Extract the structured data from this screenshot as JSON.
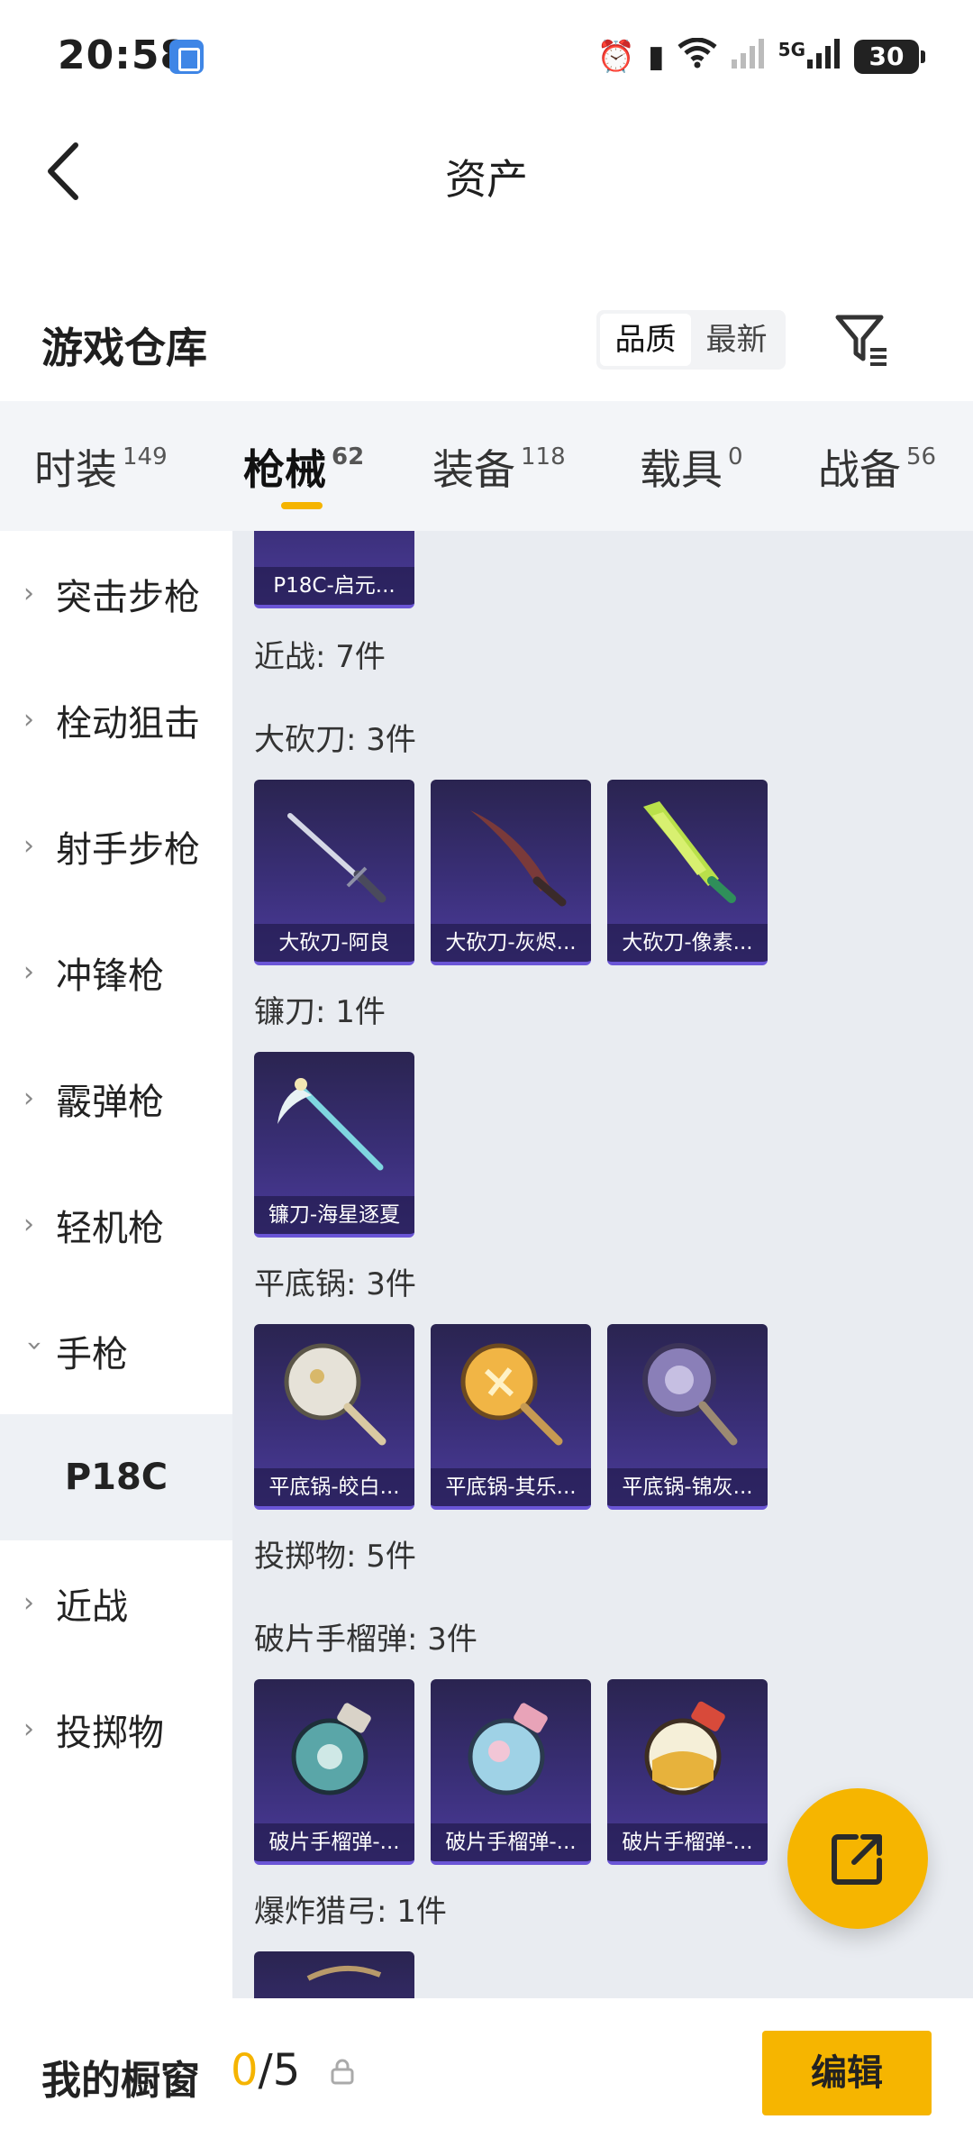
{
  "status_bar": {
    "time": "20:58",
    "network": "5G",
    "battery": "30",
    "icons": [
      "alarm-icon",
      "vibrate-icon",
      "wifi-icon",
      "signal-icon",
      "signal-5g-icon",
      "battery-icon"
    ]
  },
  "header": {
    "title": "资产"
  },
  "warehouse": {
    "title": "游戏仓库",
    "sort_options": [
      "品质",
      "最新"
    ],
    "active_sort": "品质"
  },
  "tabs": [
    {
      "label": "时装",
      "count": "149"
    },
    {
      "label": "枪械",
      "count": "62",
      "active": true
    },
    {
      "label": "装备",
      "count": "118"
    },
    {
      "label": "载具",
      "count": "0"
    },
    {
      "label": "战备",
      "count": "56"
    }
  ],
  "sidebar": {
    "items": [
      {
        "label": "突击步枪"
      },
      {
        "label": "栓动狙击"
      },
      {
        "label": "射手步枪"
      },
      {
        "label": "冲锋枪"
      },
      {
        "label": "霰弹枪"
      },
      {
        "label": "轻机枪"
      },
      {
        "label": "手枪",
        "expanded": true
      },
      {
        "label": "近战"
      },
      {
        "label": "投掷物"
      }
    ],
    "active_sub": "P18C"
  },
  "content": {
    "top_card": "P18C-启元...",
    "groups": [
      {
        "label": "近战: 7件"
      },
      {
        "label": "大砍刀: 3件",
        "items": [
          "大砍刀-阿良",
          "大砍刀-灰烬...",
          "大砍刀-像素..."
        ]
      },
      {
        "label": "镰刀: 1件",
        "items": [
          "镰刀-海星逐夏"
        ]
      },
      {
        "label": "平底锅: 3件",
        "items": [
          "平底锅-皎白...",
          "平底锅-其乐...",
          "平底锅-锦灰..."
        ]
      },
      {
        "label": "投掷物: 5件"
      },
      {
        "label": "破片手榴弹: 3件",
        "items": [
          "破片手榴弹-...",
          "破片手榴弹-...",
          "破片手榴弹-..."
        ]
      },
      {
        "label": "爆炸猎弓: 1件"
      }
    ]
  },
  "showcase": {
    "label": "我的橱窗",
    "current": "0",
    "total": "/5",
    "edit_label": "编辑"
  },
  "colors": {
    "accent": "#f6b500",
    "card_bg": "#3a2f78",
    "content_bg": "#e9ecf1"
  }
}
